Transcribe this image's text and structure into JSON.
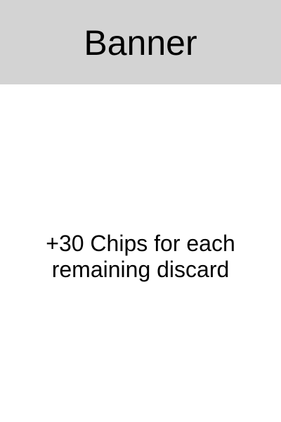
{
  "card": {
    "banner": "Banner",
    "effect_text": "+30 Chips for each remaining discard"
  },
  "colors": {
    "banner_background": "#d3d3d3",
    "card_background": "#ffffff",
    "text": "#000000"
  }
}
